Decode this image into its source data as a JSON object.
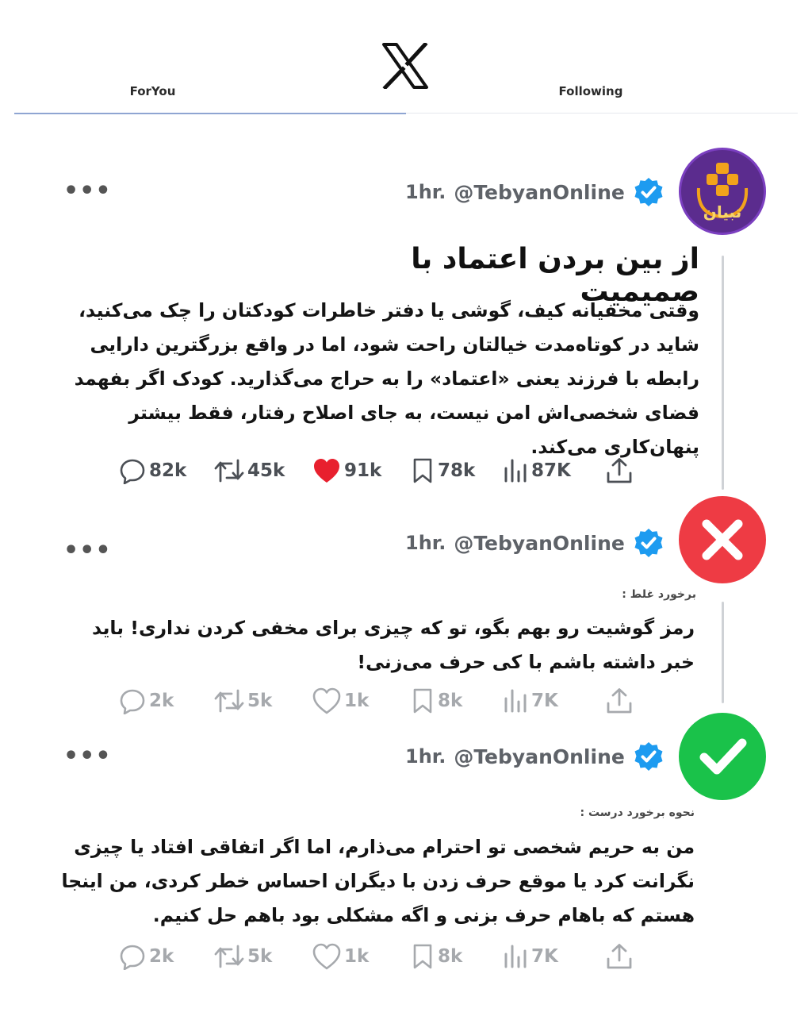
{
  "header": {
    "tab_foryou": "ForYou",
    "tab_following": "Following",
    "logo": "x-logo"
  },
  "tweets": [
    {
      "time": "1hr.",
      "handle": "@TebyanOnline",
      "avatar": "tebyan-logo",
      "avatar_text": "تبیان",
      "title": "از بین بردن اعتماد با صمیمیت",
      "body": "وقتی مخفیانه کیف، گوشی یا دفتر خاطرات کودکتان را چک می‌کنید، شاید در کوتاه‌مدت خیالتان راحت شود، اما در واقع بزرگترین دارایی رابطه با فرزند یعنی «اعتماد» را به حراج می‌گذارید. کودک اگر بفهمد فضای شخصی‌اش امن نیست، به جای اصلاح رفتار، فقط بیشتر پنهان‌کاری می‌کند.",
      "stats": {
        "replies": "82k",
        "retweets": "45k",
        "likes": "91k",
        "bookmarks": "78k",
        "views": "87K"
      }
    },
    {
      "time": "1hr.",
      "handle": "@TebyanOnline",
      "avatar": "x-mark-icon",
      "label": "برخورد غلط :",
      "body": "رمز گوشیت رو بهم بگو، تو که چیزی برای مخفی کردن نداری! باید خبر داشته باشم با کی حرف می‌زنی!",
      "stats": {
        "replies": "2k",
        "retweets": "5k",
        "likes": "1k",
        "bookmarks": "8k",
        "views": "7K"
      }
    },
    {
      "time": "1hr.",
      "handle": "@TebyanOnline",
      "avatar": "check-mark-icon",
      "label": "نحوه برخورد درست :",
      "body": "من به حریم شخصی تو احترام می‌ذارم، اما اگر اتفاقی افتاد یا چیزی نگرانت کرد یا موقع حرف زدن با دیگران احساس خطر کردی، من اینجا هستم که باهام حرف بزنی و اگه مشکلی بود باهم حل کنیم.",
      "stats": {
        "replies": "2k",
        "retweets": "5k",
        "likes": "1k",
        "bookmarks": "8k",
        "views": "7K"
      }
    }
  ],
  "colors": {
    "like_active": "#e8202e",
    "verified": "#1d9bf0",
    "wrong": "#ee3b44",
    "right": "#1ac24a",
    "brand_purple": "#5b2c8e",
    "brand_orange": "#f2a31b"
  }
}
